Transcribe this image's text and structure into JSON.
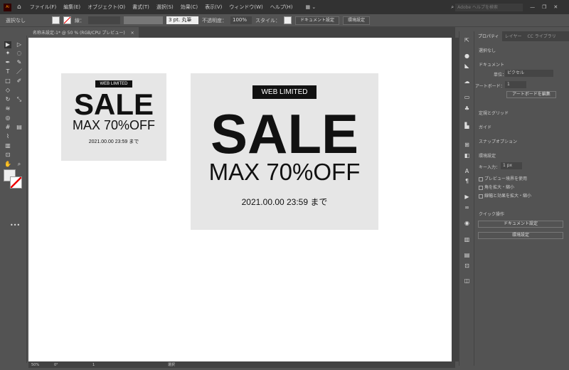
{
  "menubar": {
    "items": [
      "ファイル(F)",
      "編集(E)",
      "オブジェクト(O)",
      "書式(T)",
      "選択(S)",
      "効果(C)",
      "表示(V)",
      "ウィンドウ(W)",
      "ヘルプ(H)"
    ],
    "search_placeholder": "Adobe ヘルプを検索"
  },
  "control": {
    "selection": "選択なし",
    "stroke_label": "線：",
    "brush": "3 pt. 丸筆",
    "opacity_label": "不透明度：",
    "opacity": "100%",
    "style_label": "スタイル：",
    "doc_settings": "ドキュメント設定",
    "preferences": "環境設定"
  },
  "tab": {
    "title": "名称未設定-1* @ 50 % (RGB/CPU プレビュー)",
    "close": "×"
  },
  "artboards": [
    {
      "badge": "WEB LIMITED",
      "headline": "SALE",
      "sub": "MAX 70%OFF",
      "date": "2021.00.00 23:59 まで"
    },
    {
      "badge": "WEB LIMITED",
      "headline": "SALE",
      "sub": "MAX 70%OFF",
      "date": "2021.00.00 23:59 まで"
    }
  ],
  "status": {
    "zoom": "50%",
    "rotate": "0°",
    "artboard": "1",
    "tool": "選択"
  },
  "panel": {
    "tabs": [
      "プロパティ",
      "レイヤー",
      "CC ライブラリ"
    ],
    "selection": "選択なし",
    "document": "ドキュメント",
    "units_label": "単位：",
    "units": "ピクセル",
    "artboard_label": "アートボード：",
    "artboard": "1",
    "edit_artboard": "アートボードを編集",
    "rulers_grid": "定規とグリッド",
    "guides": "ガイド",
    "snap": "スナップオプション",
    "prefs_heading": "環境設定",
    "key_label": "キー入力：",
    "key_value": "1 px",
    "checks": [
      "プレビュー境界を使用",
      "角を拡大・縮小",
      "線幅と効果を拡大・縮小"
    ],
    "quick": "クイック操作",
    "doc_settings": "ドキュメント設定",
    "preferences": "環境設定"
  }
}
